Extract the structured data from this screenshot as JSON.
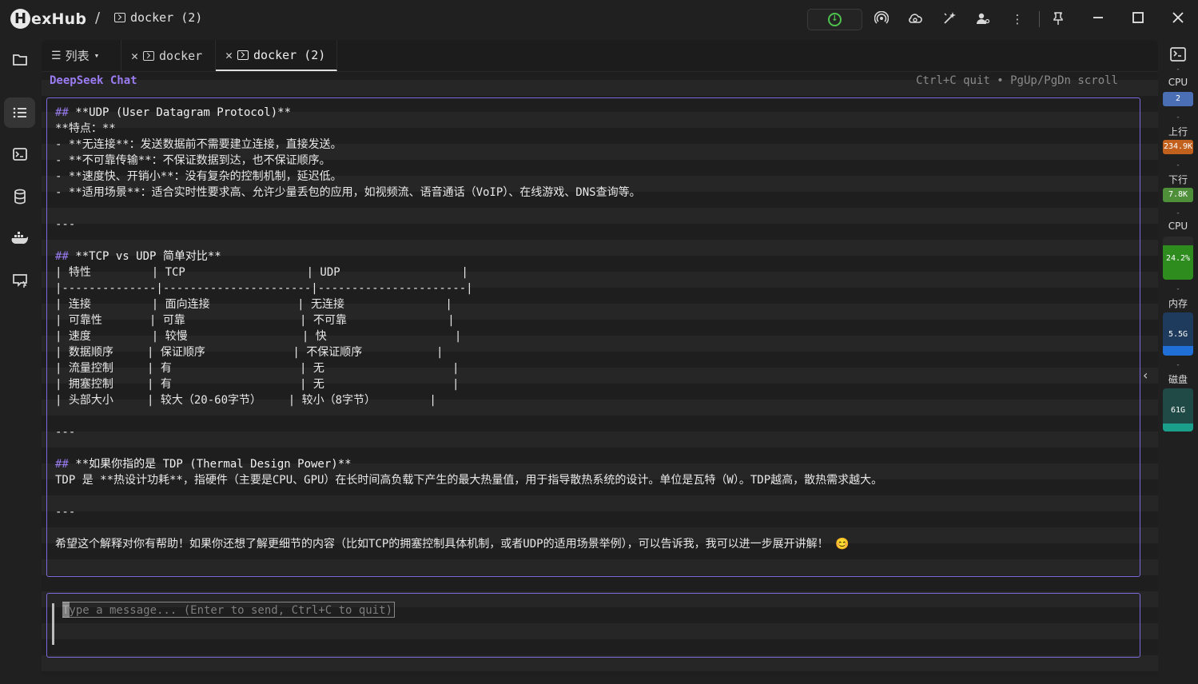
{
  "app": {
    "name_initial": "H",
    "name_rest": "exHub",
    "breadcrumb_sep": "/",
    "current_tab": "docker (2)"
  },
  "tabs": [
    {
      "label": "列表",
      "type": "list"
    },
    {
      "label": "docker",
      "type": "terminal"
    },
    {
      "label": "docker (2)",
      "type": "terminal",
      "active": true
    }
  ],
  "terminal": {
    "title": "DeepSeek Chat",
    "hint": "Ctrl+C quit • PgUp/PgDn scroll",
    "lines": [
      {
        "hash": "##",
        "text": " **UDP (User Datagram Protocol)**",
        "heading": true
      },
      {
        "hash": "",
        "text": "**特点：**"
      },
      {
        "hash": "",
        "text": "- **无连接**：发送数据前不需要建立连接，直接发送。"
      },
      {
        "hash": "",
        "text": "- **不可靠传输**：不保证数据到达，也不保证顺序。"
      },
      {
        "hash": "",
        "text": "- **速度快、开销小**：没有复杂的控制机制，延迟低。"
      },
      {
        "hash": "",
        "text": "- **适用场景**：适合实时性要求高、允许少量丢包的应用，如视频流、语音通话（VoIP）、在线游戏、DNS查询等。"
      },
      {
        "hash": "",
        "text": ""
      },
      {
        "hash": "",
        "text": "---"
      },
      {
        "hash": "",
        "text": ""
      },
      {
        "hash": "##",
        "text": " **TCP vs UDP 简单对比**",
        "heading": true
      },
      {
        "hash": "",
        "text": "| 特性         | TCP                  | UDP                  |"
      },
      {
        "hash": "",
        "text": "|--------------|----------------------|----------------------|"
      },
      {
        "hash": "",
        "text": "| 连接         | 面向连接             | 无连接               |"
      },
      {
        "hash": "",
        "text": "| 可靠性       | 可靠                 | 不可靠               |"
      },
      {
        "hash": "",
        "text": "| 速度         | 较慢                 | 快                   |"
      },
      {
        "hash": "",
        "text": "| 数据顺序     | 保证顺序             | 不保证顺序           |"
      },
      {
        "hash": "",
        "text": "| 流量控制     | 有                   | 无                   |"
      },
      {
        "hash": "",
        "text": "| 拥塞控制     | 有                   | 无                   |"
      },
      {
        "hash": "",
        "text": "| 头部大小     | 较大（20-60字节）    | 较小（8字节）        |"
      },
      {
        "hash": "",
        "text": ""
      },
      {
        "hash": "",
        "text": "---"
      },
      {
        "hash": "",
        "text": ""
      },
      {
        "hash": "##",
        "text": " **如果你指的是 TDP (Thermal Design Power)**",
        "heading": true
      },
      {
        "hash": "",
        "text": "TDP 是 **热设计功耗**，指硬件（主要是CPU、GPU）在长时间高负载下产生的最大热量值，用于指导散热系统的设计。单位是瓦特（W）。TDP越高，散热需求越大。"
      },
      {
        "hash": "",
        "text": ""
      },
      {
        "hash": "",
        "text": "---"
      },
      {
        "hash": "",
        "text": ""
      },
      {
        "hash": "",
        "text": "希望这个解释对你有帮助！如果你还想了解更细节的内容（比如TCP的拥塞控制具体机制，或者UDP的适用场景举例），可以告诉我，我可以进一步展开讲解！ 😊"
      }
    ],
    "input_placeholder": "Type a message... (Enter to send, Ctrl+C to quit)"
  },
  "stats": {
    "cpu_cores_label": "CPU",
    "cpu_cores_value": "2",
    "upload_label": "上行",
    "upload_value": "234.9K",
    "download_label": "下行",
    "download_value": "7.8K",
    "cpu_usage_label": "CPU",
    "cpu_usage_value": "24.2%",
    "cpu_usage_fraction": 0.242,
    "mem_label": "内存",
    "mem_value": "5.5G",
    "mem_fraction": 0.22,
    "disk_label": "磁盘",
    "disk_value": "61G",
    "disk_fraction": 0.18,
    "dash": "-"
  },
  "colors": {
    "accent": "#7b6cd9",
    "title_purple": "#9a7bf0",
    "cpu_pill": "#4a6fb5",
    "upload_pill": "#c2611d",
    "download_pill": "#4f8f3a",
    "cpu_fill": "#2e8b1e",
    "mem_fill": "#1f6fd6",
    "disk_fill": "#1aa08a",
    "update_green": "#4ec24e"
  }
}
